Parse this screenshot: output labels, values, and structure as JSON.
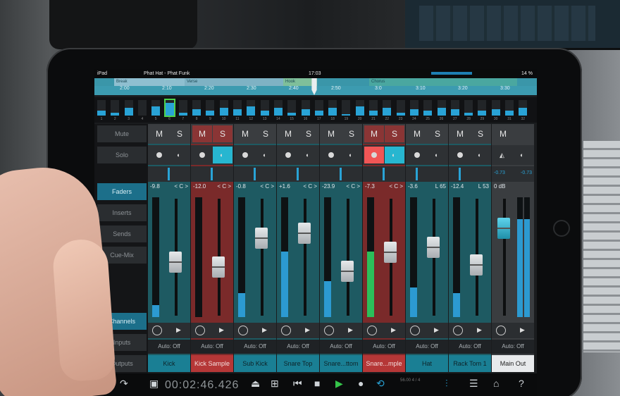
{
  "status": {
    "device": "iPad",
    "song": "Phat Hat - Phat Funk",
    "clock": "17:03",
    "battery": "14 %"
  },
  "timeline": {
    "sections": [
      "Break",
      "Verse",
      "Hook",
      "Chorus"
    ],
    "ticks": [
      "2:00",
      "2:10",
      "2:20",
      "2:30",
      "2:40",
      "2:50",
      "3:0",
      "3:10",
      "3:20",
      "3:30"
    ]
  },
  "overview": {
    "numbers": [
      "1",
      "2",
      "3",
      "4",
      "5",
      "6",
      "7",
      "8",
      "9",
      "10",
      "11",
      "12",
      "13",
      "14",
      "15",
      "16",
      "17",
      "18",
      "19",
      "20",
      "21",
      "22",
      "23",
      "24",
      "25",
      "26",
      "27",
      "28",
      "29",
      "30",
      "31",
      "32"
    ],
    "levels": [
      0.3,
      0.2,
      0.5,
      0.0,
      0.6,
      0.8,
      0.2,
      0.4,
      0.3,
      0.5,
      0.4,
      0.6,
      0.3,
      0.5,
      0.2,
      0.4,
      0.3,
      0.5,
      0.1,
      0.6,
      0.3,
      0.5,
      0.2,
      0.4,
      0.3,
      0.5,
      0.4,
      0.2,
      0.3,
      0.4,
      0.3,
      0.5
    ]
  },
  "left_panel": {
    "mute": "Mute",
    "solo": "Solo",
    "faders": "Faders",
    "inserts": "Inserts",
    "sends": "Sends",
    "cuemix": "Cue-Mix",
    "channels": "Channels",
    "inputs": "Inputs",
    "outputs": "Outputs"
  },
  "channels": [
    {
      "name": "Kick",
      "value": "-9.8",
      "pan": "< C >",
      "auto": "Auto: Off",
      "m": "M",
      "s": "S",
      "level": 0.45,
      "meter": 0.1
    },
    {
      "name": "Kick Sample",
      "value": "-12.0",
      "pan": "< C >",
      "auto": "Auto: Off",
      "m": "M",
      "s": "S",
      "level": 0.4,
      "meter": 0.0
    },
    {
      "name": "Sub Kick",
      "value": "-0.8",
      "pan": "< C >",
      "auto": "Auto: Off",
      "m": "M",
      "s": "S",
      "level": 0.7,
      "meter": 0.2
    },
    {
      "name": "Snare Top",
      "value": "+1.6",
      "pan": "< C >",
      "auto": "Auto: Off",
      "m": "M",
      "s": "S",
      "level": 0.75,
      "meter": 0.55
    },
    {
      "name": "Snare...ttom",
      "value": "-23.9",
      "pan": "< C >",
      "auto": "Auto: Off",
      "m": "M",
      "s": "S",
      "level": 0.35,
      "meter": 0.3
    },
    {
      "name": "Snare...mple",
      "value": "-7.3",
      "pan": "< C >",
      "auto": "Auto: Off",
      "m": "M",
      "s": "S",
      "level": 0.55,
      "meter": 0.55
    },
    {
      "name": "Hat",
      "value": "-3.6",
      "pan": "L 65",
      "auto": "Auto: Off",
      "m": "M",
      "s": "S",
      "level": 0.6,
      "meter": 0.25
    },
    {
      "name": "Rack Tom 1",
      "value": "-12.4",
      "pan": "L 53",
      "auto": "Auto: Off",
      "m": "M",
      "s": "S",
      "level": 0.42,
      "meter": 0.2
    }
  ],
  "main": {
    "name": "Main Out",
    "value": "0 dB",
    "left": "-0.73",
    "right": "-0.73",
    "auto": "Auto: Off",
    "m": "M",
    "level": 0.8,
    "meter": 0.82
  },
  "transport": {
    "time": "00:02:46.426",
    "small": "56.00 4 / 4"
  }
}
